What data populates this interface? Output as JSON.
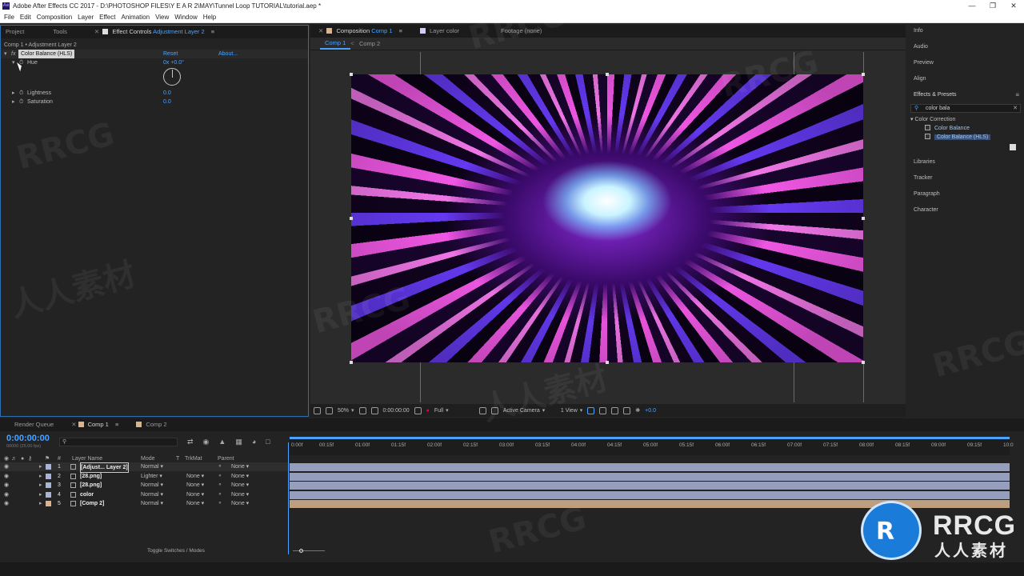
{
  "titlebar": {
    "title": "Adobe After Effects CC 2017 - D:\\PHOTOSHOP FILES\\Y E A R 2\\MAY\\Tunnel Loop TUTORIAL\\tutorial.aep *",
    "app_icon": "Ae"
  },
  "menu": [
    "File",
    "Edit",
    "Composition",
    "Layer",
    "Effect",
    "Animation",
    "View",
    "Window",
    "Help"
  ],
  "left_panel": {
    "tabs": [
      "Project",
      "Tools"
    ],
    "effect_controls_tab": "Effect Controls",
    "effect_controls_layer": "Adjustment Layer 2",
    "breadcrumb": "Comp 1 • Adjustment Layer 2",
    "effect_name": "Color Balance (HLS)",
    "reset": "Reset",
    "about": "About...",
    "props": [
      {
        "label": "Hue",
        "value": "0x +0.0°"
      },
      {
        "label": "Lightness",
        "value": "0.0"
      },
      {
        "label": "Saturation",
        "value": "0.0"
      }
    ]
  },
  "viewer": {
    "tabs": [
      {
        "label": "Composition",
        "name": "Comp 1"
      },
      {
        "label": "Layer",
        "name": "color"
      },
      {
        "label": "Footage",
        "name": "(none)"
      }
    ],
    "sub_tabs": [
      "Comp 1",
      "Comp 2"
    ],
    "zoom": "50%",
    "timecode": "0:00:00:00",
    "resolution": "Full",
    "camera": "Active Camera",
    "views": "1 View",
    "exposure": "+0.0"
  },
  "right_panel": {
    "items_top": [
      "Info",
      "Audio",
      "Preview",
      "Align"
    ],
    "effects_presets": "Effects & Presets",
    "search_value": "color bala",
    "category": "Color Correction",
    "effects": [
      "Color Balance",
      "Color Balance (HLS)"
    ],
    "items_bottom": [
      "Libraries",
      "Tracker",
      "Paragraph",
      "Character"
    ]
  },
  "timeline": {
    "tabs": [
      "Render Queue",
      "Comp 1",
      "Comp 2"
    ],
    "current_time": "0:00:00:00",
    "fps_info": "00000 (25.00 fps)",
    "columns": {
      "layer_name": "Layer Name",
      "mode": "Mode",
      "t": "T",
      "trkmat": "TrkMat",
      "parent": "Parent",
      "num": "#"
    },
    "ruler": [
      "0:00f",
      "00:15f",
      "01:00f",
      "01:15f",
      "02:00f",
      "02:15f",
      "03:00f",
      "03:15f",
      "04:00f",
      "04:15f",
      "05:00f",
      "05:15f",
      "06:00f",
      "06:15f",
      "07:00f",
      "07:15f",
      "08:00f",
      "08:15f",
      "09:00f",
      "09:15f",
      "10:0"
    ],
    "layers": [
      {
        "num": "1",
        "name": "[Adjust... Layer 2]",
        "mode": "Normal",
        "trkmat": "",
        "parent": "None",
        "color": "#a9b4d8"
      },
      {
        "num": "2",
        "name": "[28.png]",
        "mode": "Lighter",
        "trkmat": "None",
        "parent": "None",
        "color": "#a9b4d8"
      },
      {
        "num": "3",
        "name": "[28.png]",
        "mode": "Normal",
        "trkmat": "None",
        "parent": "None",
        "color": "#a9b4d8"
      },
      {
        "num": "4",
        "name": "color",
        "mode": "Normal",
        "trkmat": "None",
        "parent": "None",
        "color": "#a9b4d8"
      },
      {
        "num": "5",
        "name": "[Comp 2]",
        "mode": "Normal",
        "trkmat": "None",
        "parent": "None",
        "color": "#d8b48f"
      }
    ],
    "toggle_label": "Toggle Switches / Modes"
  },
  "watermarks": [
    "RRCG",
    "人人素材"
  ],
  "logo": {
    "big": "RRCG",
    "small": "人人素材"
  },
  "colors": {
    "accent": "#4aa3ff",
    "panel_border": "#2d6fb0",
    "selection": "#3b4e73"
  }
}
